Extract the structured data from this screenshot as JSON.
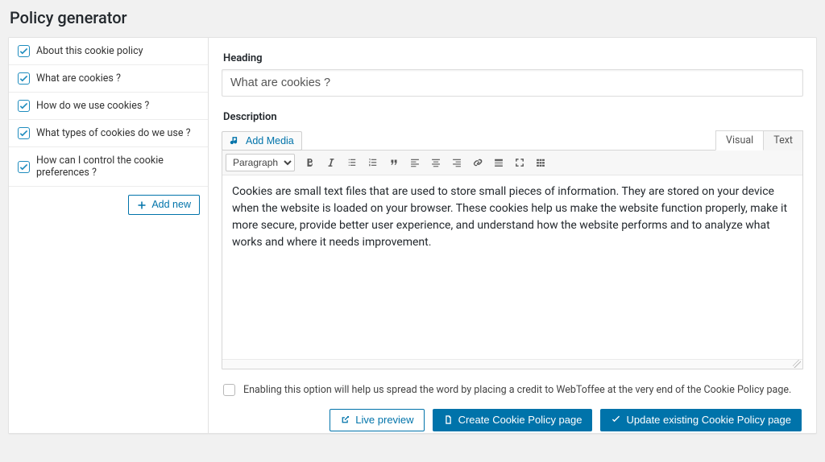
{
  "page_title": "Policy generator",
  "sidebar": {
    "items": [
      {
        "label": "About this cookie policy",
        "checked": true
      },
      {
        "label": "What are cookies ?",
        "checked": true,
        "active": true
      },
      {
        "label": "How do we use cookies ?",
        "checked": true
      },
      {
        "label": "What types of cookies do we use ?",
        "checked": true
      },
      {
        "label": "How can I control the cookie preferences ?",
        "checked": true
      }
    ],
    "add_new_label": "Add new"
  },
  "form": {
    "heading_label": "Heading",
    "heading_value": "What are cookies ?",
    "description_label": "Description",
    "add_media_label": "Add Media",
    "tabs": {
      "visual": "Visual",
      "text": "Text",
      "active": "visual"
    },
    "paragraph_select": "Paragraph",
    "content": "Cookies are small text files that are used to store small pieces of information. They are stored on your device when the website is loaded on your browser. These cookies help us make the website function properly, make it more secure, provide better user experience, and understand how the website performs and to analyze what works and where it needs improvement."
  },
  "credit": {
    "checked": false,
    "text": "Enabling this option will help us spread the word by placing a credit to WebToffee at the very end of the Cookie Policy page."
  },
  "actions": {
    "live_preview": "Live preview",
    "create": "Create Cookie Policy page",
    "update": "Update existing Cookie Policy page"
  },
  "colors": {
    "primary": "#0073aa"
  }
}
